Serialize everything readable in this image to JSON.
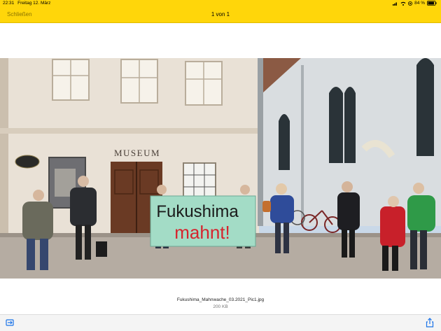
{
  "status": {
    "time": "22:31",
    "date": "Freitag 12. März",
    "battery": "84 %"
  },
  "nav": {
    "close": "Schließen",
    "counter": "1 von 1"
  },
  "photo": {
    "building_sign": "MUSEUM",
    "banner_line1": "Fukushima",
    "banner_line2": "mahnt!"
  },
  "file": {
    "name": "Fukushima_Mahnwache_03.2021_Pic1.jpg",
    "size": "200 KB"
  },
  "colors": {
    "accent": "#ffd60a",
    "banner_text_red": "#d6242e"
  },
  "icons": {
    "left": "files-icon",
    "right": "share-icon"
  }
}
